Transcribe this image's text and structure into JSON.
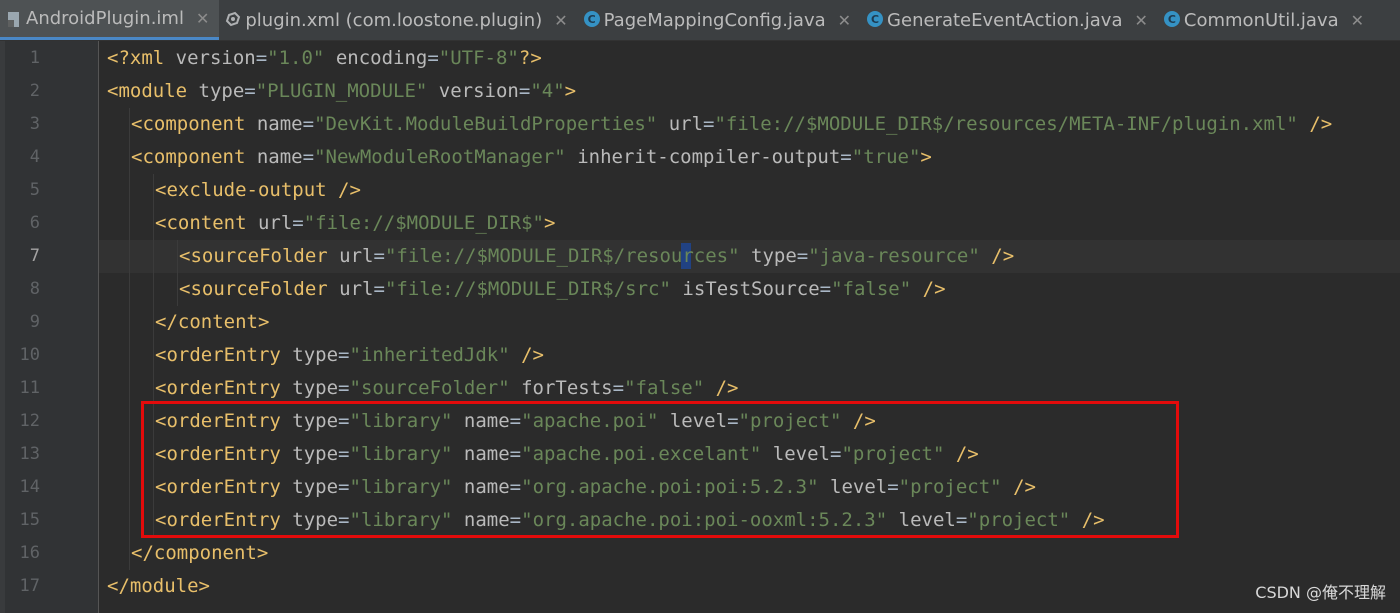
{
  "tabs": [
    {
      "label": "AndroidPlugin.iml",
      "icon": "module-file-icon",
      "active": true
    },
    {
      "label": "plugin.xml (com.loostone.plugin)",
      "icon": "plugin-xml-icon",
      "active": false
    },
    {
      "label": "PageMappingConfig.java",
      "icon": "java-class-icon",
      "active": false
    },
    {
      "label": "GenerateEventAction.java",
      "icon": "java-class-icon",
      "active": false
    },
    {
      "label": "CommonUtil.java",
      "icon": "java-class-icon",
      "active": false
    }
  ],
  "close_glyph": "✕",
  "class_icon_letter": "C",
  "current_line": 7,
  "lines": [
    {
      "n": "1",
      "indent": 0,
      "tokens": [
        [
          "pi",
          "<?xml "
        ],
        [
          "attr",
          "version"
        ],
        [
          "plain",
          "="
        ],
        [
          "val",
          "\"1.0\""
        ],
        [
          "plain",
          " "
        ],
        [
          "attr",
          "encoding"
        ],
        [
          "plain",
          "="
        ],
        [
          "val",
          "\"UTF-8\""
        ],
        [
          "pi",
          "?>"
        ]
      ]
    },
    {
      "n": "2",
      "indent": 0,
      "tokens": [
        [
          "tag",
          "<module "
        ],
        [
          "attr",
          "type"
        ],
        [
          "plain",
          "="
        ],
        [
          "val",
          "\"PLUGIN_MODULE\""
        ],
        [
          "plain",
          " "
        ],
        [
          "attr",
          "version"
        ],
        [
          "plain",
          "="
        ],
        [
          "val",
          "\"4\""
        ],
        [
          "tag",
          ">"
        ]
      ]
    },
    {
      "n": "3",
      "indent": 1,
      "tokens": [
        [
          "tag",
          "<component "
        ],
        [
          "attr",
          "name"
        ],
        [
          "plain",
          "="
        ],
        [
          "val",
          "\"DevKit.ModuleBuildProperties\""
        ],
        [
          "plain",
          " "
        ],
        [
          "attr",
          "url"
        ],
        [
          "plain",
          "="
        ],
        [
          "val",
          "\"file://$MODULE_DIR$/resources/META-INF/plugin.xml\""
        ],
        [
          "plain",
          " "
        ],
        [
          "tag",
          "/>"
        ]
      ]
    },
    {
      "n": "4",
      "indent": 1,
      "tokens": [
        [
          "tag",
          "<component "
        ],
        [
          "attr",
          "name"
        ],
        [
          "plain",
          "="
        ],
        [
          "val",
          "\"NewModuleRootManager\""
        ],
        [
          "plain",
          " "
        ],
        [
          "attr",
          "inherit-compiler-output"
        ],
        [
          "plain",
          "="
        ],
        [
          "val",
          "\"true\""
        ],
        [
          "tag",
          ">"
        ]
      ]
    },
    {
      "n": "5",
      "indent": 2,
      "tokens": [
        [
          "tag",
          "<exclude-output "
        ],
        [
          "tag",
          "/>"
        ]
      ]
    },
    {
      "n": "6",
      "indent": 2,
      "tokens": [
        [
          "tag",
          "<content "
        ],
        [
          "attr",
          "url"
        ],
        [
          "plain",
          "="
        ],
        [
          "val",
          "\"file://$MODULE_DIR$\""
        ],
        [
          "tag",
          ">"
        ]
      ]
    },
    {
      "n": "7",
      "indent": 3,
      "tokens": [
        [
          "tag",
          "<sourceFolder "
        ],
        [
          "attr",
          "url"
        ],
        [
          "plain",
          "="
        ],
        [
          "val",
          "\"file://$MODULE_DIR$/resources\""
        ],
        [
          "plain",
          " "
        ],
        [
          "attr",
          "type"
        ],
        [
          "plain",
          "="
        ],
        [
          "val",
          "\"java-resource\""
        ],
        [
          "plain",
          " "
        ],
        [
          "tag",
          "/>"
        ]
      ]
    },
    {
      "n": "8",
      "indent": 3,
      "tokens": [
        [
          "tag",
          "<sourceFolder "
        ],
        [
          "attr",
          "url"
        ],
        [
          "plain",
          "="
        ],
        [
          "val",
          "\"file://$MODULE_DIR$/src\""
        ],
        [
          "plain",
          " "
        ],
        [
          "attr",
          "isTestSource"
        ],
        [
          "plain",
          "="
        ],
        [
          "val",
          "\"false\""
        ],
        [
          "plain",
          " "
        ],
        [
          "tag",
          "/>"
        ]
      ]
    },
    {
      "n": "9",
      "indent": 2,
      "tokens": [
        [
          "tag",
          "</content>"
        ]
      ]
    },
    {
      "n": "10",
      "indent": 2,
      "tokens": [
        [
          "tag",
          "<orderEntry "
        ],
        [
          "attr",
          "type"
        ],
        [
          "plain",
          "="
        ],
        [
          "val",
          "\"inheritedJdk\""
        ],
        [
          "plain",
          " "
        ],
        [
          "tag",
          "/>"
        ]
      ]
    },
    {
      "n": "11",
      "indent": 2,
      "tokens": [
        [
          "tag",
          "<orderEntry "
        ],
        [
          "attr",
          "type"
        ],
        [
          "plain",
          "="
        ],
        [
          "val",
          "\"sourceFolder\""
        ],
        [
          "plain",
          " "
        ],
        [
          "attr",
          "forTests"
        ],
        [
          "plain",
          "="
        ],
        [
          "val",
          "\"false\""
        ],
        [
          "plain",
          " "
        ],
        [
          "tag",
          "/>"
        ]
      ]
    },
    {
      "n": "12",
      "indent": 2,
      "tokens": [
        [
          "tag",
          "<orderEntry "
        ],
        [
          "attr",
          "type"
        ],
        [
          "plain",
          "="
        ],
        [
          "val",
          "\"library\""
        ],
        [
          "plain",
          " "
        ],
        [
          "attr",
          "name"
        ],
        [
          "plain",
          "="
        ],
        [
          "val",
          "\"apache.poi\""
        ],
        [
          "plain",
          " "
        ],
        [
          "attr",
          "level"
        ],
        [
          "plain",
          "="
        ],
        [
          "val",
          "\"project\""
        ],
        [
          "plain",
          " "
        ],
        [
          "tag",
          "/>"
        ]
      ]
    },
    {
      "n": "13",
      "indent": 2,
      "tokens": [
        [
          "tag",
          "<orderEntry "
        ],
        [
          "attr",
          "type"
        ],
        [
          "plain",
          "="
        ],
        [
          "val",
          "\"library\""
        ],
        [
          "plain",
          " "
        ],
        [
          "attr",
          "name"
        ],
        [
          "plain",
          "="
        ],
        [
          "val",
          "\"apache.poi.excelant\""
        ],
        [
          "plain",
          " "
        ],
        [
          "attr",
          "level"
        ],
        [
          "plain",
          "="
        ],
        [
          "val",
          "\"project\""
        ],
        [
          "plain",
          " "
        ],
        [
          "tag",
          "/>"
        ]
      ]
    },
    {
      "n": "14",
      "indent": 2,
      "tokens": [
        [
          "tag",
          "<orderEntry "
        ],
        [
          "attr",
          "type"
        ],
        [
          "plain",
          "="
        ],
        [
          "val",
          "\"library\""
        ],
        [
          "plain",
          " "
        ],
        [
          "attr",
          "name"
        ],
        [
          "plain",
          "="
        ],
        [
          "val",
          "\"org.apache.poi:poi:5.2.3\""
        ],
        [
          "plain",
          " "
        ],
        [
          "attr",
          "level"
        ],
        [
          "plain",
          "="
        ],
        [
          "val",
          "\"project\""
        ],
        [
          "plain",
          " "
        ],
        [
          "tag",
          "/>"
        ]
      ]
    },
    {
      "n": "15",
      "indent": 2,
      "tokens": [
        [
          "tag",
          "<orderEntry "
        ],
        [
          "attr",
          "type"
        ],
        [
          "plain",
          "="
        ],
        [
          "val",
          "\"library\""
        ],
        [
          "plain",
          " "
        ],
        [
          "attr",
          "name"
        ],
        [
          "plain",
          "="
        ],
        [
          "val",
          "\"org.apache.poi:poi-ooxml:5.2.3\""
        ],
        [
          "plain",
          " "
        ],
        [
          "attr",
          "level"
        ],
        [
          "plain",
          "="
        ],
        [
          "val",
          "\"project\""
        ],
        [
          "plain",
          " "
        ],
        [
          "tag",
          "/>"
        ]
      ]
    },
    {
      "n": "16",
      "indent": 1,
      "tokens": [
        [
          "tag",
          "</component>"
        ]
      ]
    },
    {
      "n": "17",
      "indent": 0,
      "tokens": [
        [
          "tag",
          "</module>"
        ]
      ]
    }
  ],
  "watermark": "CSDN @俺不理解",
  "colors": {
    "tag": "#e8bf6a",
    "attr": "#bababa",
    "value": "#6a8759",
    "highlight_box": "#e30b0b",
    "background": "#2b2b2b"
  }
}
